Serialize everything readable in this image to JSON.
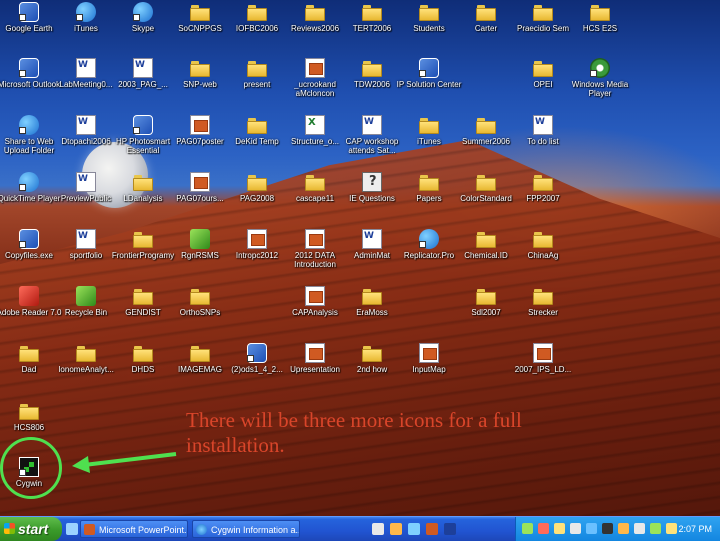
{
  "desktop": {
    "icons": [
      {
        "label": "Google Earth",
        "type": "app",
        "col": 0,
        "row": 0
      },
      {
        "label": "iTunes",
        "type": "round",
        "col": 1,
        "row": 0
      },
      {
        "label": "Skype",
        "type": "round",
        "col": 2,
        "row": 0
      },
      {
        "label": "SoCNPPGS",
        "type": "folder",
        "col": 3,
        "row": 0
      },
      {
        "label": "IOFBC2006",
        "type": "folder",
        "col": 4,
        "row": 0
      },
      {
        "label": "Reviews2006",
        "type": "folder",
        "col": 5,
        "row": 0
      },
      {
        "label": "TERT2006",
        "type": "folder",
        "col": 6,
        "row": 0
      },
      {
        "label": "Students",
        "type": "folder",
        "col": 7,
        "row": 0
      },
      {
        "label": "Carter",
        "type": "folder",
        "col": 8,
        "row": 0
      },
      {
        "label": "Praecidio Sem",
        "type": "folder",
        "col": 9,
        "row": 0
      },
      {
        "label": "HCS E2S",
        "type": "folder",
        "col": 10,
        "row": 0
      },
      {
        "label": "Microsoft Outlook",
        "type": "app",
        "col": 0,
        "row": 1
      },
      {
        "label": "LabMeeting0...",
        "type": "doc",
        "col": 1,
        "row": 1
      },
      {
        "label": "2003_PAG_...",
        "type": "doc",
        "col": 2,
        "row": 1
      },
      {
        "label": "SNP-web",
        "type": "folder",
        "col": 3,
        "row": 1
      },
      {
        "label": "present",
        "type": "folder",
        "col": 4,
        "row": 1
      },
      {
        "label": "_ucrookand aMcloncon",
        "type": "ppt",
        "col": 5,
        "row": 1
      },
      {
        "label": "TDW2006",
        "type": "folder",
        "col": 6,
        "row": 1
      },
      {
        "label": "IP Solution Center",
        "type": "app",
        "col": 7,
        "row": 1
      },
      {
        "label": "OPEI",
        "type": "folder",
        "col": 9,
        "row": 1
      },
      {
        "label": "Windows Media Player",
        "type": "media",
        "col": 10,
        "row": 1
      },
      {
        "label": "Share to Web Upload Folder",
        "type": "round",
        "col": 0,
        "row": 2
      },
      {
        "label": "Dtopachi2006",
        "type": "doc",
        "col": 1,
        "row": 2
      },
      {
        "label": "HP Photosmart Essential",
        "type": "app",
        "col": 2,
        "row": 2
      },
      {
        "label": "PAG07poster",
        "type": "ppt",
        "col": 3,
        "row": 2
      },
      {
        "label": "DeKid Temp",
        "type": "folder",
        "col": 4,
        "row": 2
      },
      {
        "label": "Structure_o...",
        "type": "xls",
        "col": 5,
        "row": 2
      },
      {
        "label": "CAP workshop attends Sat...",
        "type": "doc",
        "col": 6,
        "row": 2
      },
      {
        "label": "iTunes",
        "type": "folder",
        "col": 7,
        "row": 2
      },
      {
        "label": "Summer2006",
        "type": "folder",
        "col": 8,
        "row": 2
      },
      {
        "label": "To do list",
        "type": "doc",
        "col": 9,
        "row": 2
      },
      {
        "label": "QuickTime Player",
        "type": "round",
        "col": 0,
        "row": 3
      },
      {
        "label": "PreviewPublic",
        "type": "doc",
        "col": 1,
        "row": 3
      },
      {
        "label": "LDanalysis",
        "type": "folder",
        "col": 2,
        "row": 3
      },
      {
        "label": "PAG07ours...",
        "type": "ppt",
        "col": 3,
        "row": 3
      },
      {
        "label": "PAG2008",
        "type": "folder",
        "col": 4,
        "row": 3
      },
      {
        "label": "cascape11",
        "type": "folder",
        "col": 5,
        "row": 3
      },
      {
        "label": "IE Questions",
        "type": "help",
        "col": 6,
        "row": 3
      },
      {
        "label": "Papers",
        "type": "folder",
        "col": 7,
        "row": 3
      },
      {
        "label": "ColorStandard",
        "type": "folder",
        "col": 8,
        "row": 3
      },
      {
        "label": "FPP2007",
        "type": "folder",
        "col": 9,
        "row": 3
      },
      {
        "label": "Copyfiles.exe",
        "type": "app",
        "col": 0,
        "row": 4
      },
      {
        "label": "sportfolio",
        "type": "doc",
        "col": 1,
        "row": 4
      },
      {
        "label": "FrontierProgramy",
        "type": "folder",
        "col": 2,
        "row": 4
      },
      {
        "label": "RgnRSMS",
        "type": "green",
        "col": 3,
        "row": 4
      },
      {
        "label": "Intropc2012",
        "type": "ppt",
        "col": 4,
        "row": 4
      },
      {
        "label": "2012 DATA Introduction",
        "type": "ppt",
        "col": 5,
        "row": 4
      },
      {
        "label": "AdminMat",
        "type": "doc",
        "col": 6,
        "row": 4
      },
      {
        "label": "Replicator.Pro",
        "type": "round",
        "col": 7,
        "row": 4
      },
      {
        "label": "Chemical.ID",
        "type": "folder",
        "col": 8,
        "row": 4
      },
      {
        "label": "ChinaAg",
        "type": "folder",
        "col": 9,
        "row": 4
      },
      {
        "label": "Adobe Reader 7.0",
        "type": "red",
        "col": 0,
        "row": 5
      },
      {
        "label": "Recycle Bin",
        "type": "green",
        "col": 1,
        "row": 5
      },
      {
        "label": "GENDIST",
        "type": "folder",
        "col": 2,
        "row": 5
      },
      {
        "label": "OrthoSNPs",
        "type": "folder",
        "col": 3,
        "row": 5
      },
      {
        "label": "CAPAnalysis",
        "type": "ppt",
        "col": 5,
        "row": 5
      },
      {
        "label": "EraMoss",
        "type": "folder",
        "col": 6,
        "row": 5
      },
      {
        "label": "Sdl2007",
        "type": "folder",
        "col": 8,
        "row": 5
      },
      {
        "label": "Strecker",
        "type": "folder",
        "col": 9,
        "row": 5
      },
      {
        "label": "Dad",
        "type": "folder",
        "col": 0,
        "row": 6
      },
      {
        "label": "IonomeAnalyt...",
        "type": "folder",
        "col": 1,
        "row": 6
      },
      {
        "label": "DHDS",
        "type": "folder",
        "col": 2,
        "row": 6
      },
      {
        "label": "IMAGEMAG",
        "type": "folder",
        "col": 3,
        "row": 6
      },
      {
        "label": "(2)ods1_4_2...",
        "type": "app",
        "col": 4,
        "row": 6
      },
      {
        "label": "Upresentation",
        "type": "ppt",
        "col": 5,
        "row": 6
      },
      {
        "label": "2nd how",
        "type": "folder",
        "col": 6,
        "row": 6
      },
      {
        "label": "InputMap",
        "type": "ppt",
        "col": 7,
        "row": 6
      },
      {
        "label": "2007_IPS_LD...",
        "type": "ppt",
        "col": 9,
        "row": 6
      },
      {
        "label": "HCS806",
        "type": "folder",
        "col": 0,
        "row": 7
      },
      {
        "label": "Cygwin",
        "type": "cyg",
        "col": 0,
        "row": 8
      }
    ]
  },
  "annotation": {
    "text": "There will be three more icons for a full installation."
  },
  "taskbar": {
    "start_label": "start",
    "tasks": [
      {
        "label": "Microsoft PowerPoint..."
      },
      {
        "label": "Cygwin Information a..."
      }
    ],
    "clock": "2:07 PM"
  },
  "colors": {
    "annotation_text": "#d9452a",
    "highlight": "#4fe04f",
    "taskbar": "#2154d1",
    "start_button": "#3a9a2a"
  }
}
